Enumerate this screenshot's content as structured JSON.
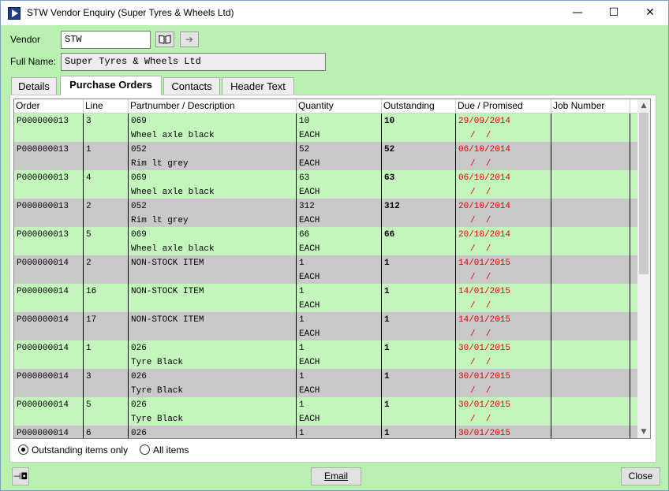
{
  "window": {
    "title": "STW Vendor Enquiry (Super Tyres & Wheels Ltd)",
    "minimize": "—",
    "maximize": "☐",
    "close": "✕"
  },
  "form": {
    "vendor_label": "Vendor",
    "vendor_value": "STW",
    "fullname_label": "Full Name:",
    "fullname_value": "Super Tyres & Wheels Ltd",
    "lookup_icon": "book-icon",
    "go_icon": "arrow-right-icon"
  },
  "tabs": [
    {
      "label": "Details"
    },
    {
      "label": "Purchase Orders"
    },
    {
      "label": "Contacts"
    },
    {
      "label": "Header Text"
    }
  ],
  "active_tab": "Purchase Orders",
  "table": {
    "columns": [
      "Order",
      "Line",
      "Partnumber / Description",
      "Quantity",
      "Outstanding",
      "Due / Promised",
      "Job Number"
    ],
    "rows": [
      {
        "order": "P000000013",
        "line": "3",
        "part": "069",
        "desc": "Wheel axle black",
        "qty": "10",
        "uom": "EACH",
        "outstanding": "10",
        "due": "29/09/2014",
        "promised": "/  /",
        "job": ""
      },
      {
        "order": "P000000013",
        "line": "1",
        "part": "052",
        "desc": "Rim lt grey",
        "qty": "52",
        "uom": "EACH",
        "outstanding": "52",
        "due": "06/10/2014",
        "promised": "/  /",
        "job": ""
      },
      {
        "order": "P000000013",
        "line": "4",
        "part": "069",
        "desc": "Wheel axle black",
        "qty": "63",
        "uom": "EACH",
        "outstanding": "63",
        "due": "06/10/2014",
        "promised": "/  /",
        "job": ""
      },
      {
        "order": "P000000013",
        "line": "2",
        "part": "052",
        "desc": "Rim lt grey",
        "qty": "312",
        "uom": "EACH",
        "outstanding": "312",
        "due": "20/10/2014",
        "promised": "/  /",
        "job": ""
      },
      {
        "order": "P000000013",
        "line": "5",
        "part": "069",
        "desc": "Wheel axle black",
        "qty": "66",
        "uom": "EACH",
        "outstanding": "66",
        "due": "20/10/2014",
        "promised": "/  /",
        "job": ""
      },
      {
        "order": "P000000014",
        "line": "2",
        "part": "NON-STOCK ITEM",
        "desc": "",
        "qty": "1",
        "uom": "EACH",
        "outstanding": "1",
        "due": "14/01/2015",
        "promised": "/  /",
        "job": ""
      },
      {
        "order": "P000000014",
        "line": "16",
        "part": "NON-STOCK ITEM",
        "desc": "",
        "qty": "1",
        "uom": "EACH",
        "outstanding": "1",
        "due": "14/01/2015",
        "promised": "/  /",
        "job": ""
      },
      {
        "order": "P000000014",
        "line": "17",
        "part": "NON-STOCK ITEM",
        "desc": "",
        "qty": "1",
        "uom": "EACH",
        "outstanding": "1",
        "due": "14/01/2015",
        "promised": "/  /",
        "job": ""
      },
      {
        "order": "P000000014",
        "line": "1",
        "part": "026",
        "desc": "Tyre Black",
        "qty": "1",
        "uom": "EACH",
        "outstanding": "1",
        "due": "30/01/2015",
        "promised": "/  /",
        "job": ""
      },
      {
        "order": "P000000014",
        "line": "3",
        "part": "026",
        "desc": "Tyre Black",
        "qty": "1",
        "uom": "EACH",
        "outstanding": "1",
        "due": "30/01/2015",
        "promised": "/  /",
        "job": ""
      },
      {
        "order": "P000000014",
        "line": "5",
        "part": "026",
        "desc": "Tyre Black",
        "qty": "1",
        "uom": "EACH",
        "outstanding": "1",
        "due": "30/01/2015",
        "promised": "/  /",
        "job": ""
      },
      {
        "order": "P000000014",
        "line": "6",
        "part": "026",
        "desc": "",
        "qty": "1",
        "uom": "",
        "outstanding": "1",
        "due": "30/01/2015",
        "promised": "",
        "job": ""
      }
    ]
  },
  "filter": {
    "option_outstanding": "Outstanding items only",
    "option_all": "All items",
    "selected": "Outstanding items only"
  },
  "footer": {
    "pin_icon": "pin-icon",
    "email_label": "Email",
    "close_label": "Close"
  },
  "colors": {
    "window_bg": "#b9f2b0",
    "row_green": "#c4f5bd",
    "row_grey": "#c9c9c9",
    "due_red": "#e00000"
  }
}
